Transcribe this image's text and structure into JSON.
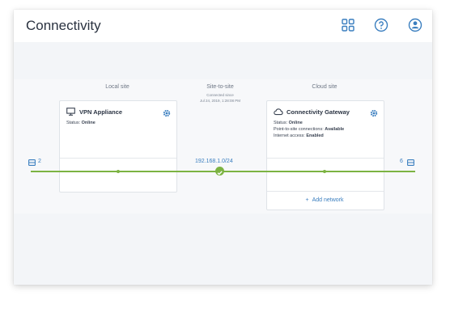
{
  "header": {
    "title": "Connectivity",
    "icons": [
      "grid-icon",
      "help-icon",
      "account-icon"
    ]
  },
  "columns": {
    "local": {
      "label": "Local site"
    },
    "middle": {
      "label": "Site-to-site",
      "connected_since_label": "Connected since",
      "connected_since_value": "Jul 24, 2019, 1:28:08 PM"
    },
    "cloud": {
      "label": "Cloud site"
    }
  },
  "vpn_card": {
    "title": "VPN Appliance",
    "status_label": "Status:",
    "status_value": "Online"
  },
  "gateway_card": {
    "title": "Connectivity Gateway",
    "status_label": "Status:",
    "status_value": "Online",
    "p2s_label": "Point-to-site connections:",
    "p2s_value": "Available",
    "internet_label": "Internet access:",
    "internet_value": "Enabled"
  },
  "connection": {
    "ip": "192.168.1.0/24",
    "left_count": "2",
    "right_count": "6"
  },
  "add_network_label": "Add network",
  "colors": {
    "accent": "#3a7ebf",
    "online": "#7cb342"
  }
}
